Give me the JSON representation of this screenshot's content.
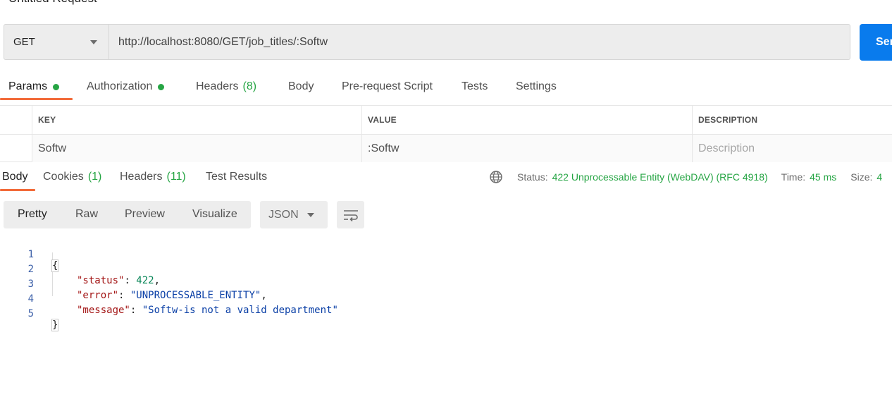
{
  "request": {
    "title_fragment": "Untitled Request",
    "method": "GET",
    "url": "http://localhost:8080/GET/job_titles/:Softw",
    "send_label": "Send"
  },
  "request_tabs": [
    {
      "label": "Params",
      "dot": true,
      "active": true
    },
    {
      "label": "Authorization",
      "dot": true
    },
    {
      "label": "Headers",
      "count": "(8)"
    },
    {
      "label": "Body"
    },
    {
      "label": "Pre-request Script"
    },
    {
      "label": "Tests"
    },
    {
      "label": "Settings"
    }
  ],
  "params_table": {
    "headers": [
      "KEY",
      "VALUE",
      "DESCRIPTION"
    ],
    "rows": [
      {
        "key": "Softw",
        "value": ":Softw",
        "description_placeholder": "Description"
      }
    ]
  },
  "response_tabs": [
    {
      "label": "Body",
      "active": true
    },
    {
      "label": "Cookies",
      "count": "(1)"
    },
    {
      "label": "Headers",
      "count": "(11)"
    },
    {
      "label": "Test Results"
    }
  ],
  "response_status": {
    "status_label": "Status:",
    "status_value": "422 Unprocessable Entity (WebDAV) (RFC 4918)",
    "time_label": "Time:",
    "time_value": "45 ms",
    "size_label": "Size:",
    "size_value": "4"
  },
  "format_toolbar": {
    "modes": [
      "Pretty",
      "Raw",
      "Preview",
      "Visualize"
    ],
    "active_mode": "Pretty",
    "language": "JSON",
    "wrap_icon": "wrap-lines-icon"
  },
  "response_body": {
    "line_numbers": [
      "1",
      "2",
      "3",
      "4",
      "5"
    ],
    "open_brace": "{",
    "close_brace": "}",
    "fields": [
      {
        "key": "\"status\"",
        "sep": ": ",
        "value": "422",
        "trail": ",",
        "kind": "num"
      },
      {
        "key": "\"error\"",
        "sep": ": ",
        "value": "\"UNPROCESSABLE_ENTITY\"",
        "trail": ",",
        "kind": "str"
      },
      {
        "key": "\"message\"",
        "sep": ": ",
        "value": "\"Softw-is not a valid department\"",
        "trail": "",
        "kind": "str"
      }
    ]
  },
  "colors": {
    "accent_orange": "#f26b3a",
    "status_green": "#26a544",
    "send_blue": "#097bed"
  }
}
